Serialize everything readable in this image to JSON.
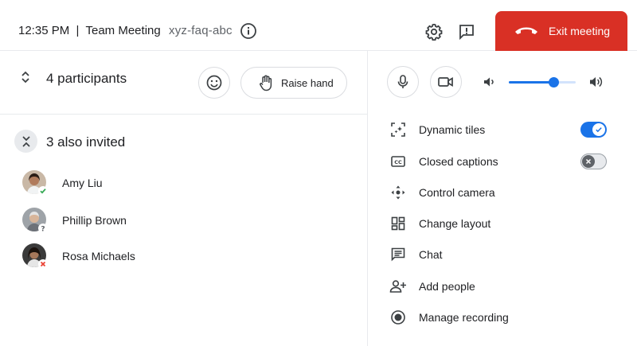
{
  "header": {
    "time_title": "12:35 PM  |  Team Meeting",
    "meeting_code": "xyz-faq-abc",
    "exit_label": "Exit meeting"
  },
  "participants": {
    "count_label": "4 participants",
    "raise_hand_label": "Raise hand",
    "invited_label": "3 also invited",
    "people": [
      {
        "name": "Amy Liu",
        "status": "accepted"
      },
      {
        "name": "Phillip Brown",
        "status": "maybe"
      },
      {
        "name": "Rosa Michaels",
        "status": "declined"
      }
    ]
  },
  "audio": {
    "volume_fraction": 0.67
  },
  "menu": {
    "items": [
      {
        "label": "Dynamic tiles",
        "icon": "dynamic-tiles-icon",
        "toggle": true
      },
      {
        "label": "Closed captions",
        "icon": "closed-captions-icon",
        "toggle": false
      },
      {
        "label": "Control camera",
        "icon": "control-camera-icon"
      },
      {
        "label": "Change layout",
        "icon": "layout-icon"
      },
      {
        "label": "Chat",
        "icon": "chat-icon"
      },
      {
        "label": "Add people",
        "icon": "add-people-icon"
      },
      {
        "label": "Manage recording",
        "icon": "record-icon"
      }
    ]
  },
  "colors": {
    "exit_red": "#d93025",
    "accent_blue": "#1a73e8",
    "status_green": "#34a853",
    "status_red": "#ea4335",
    "status_grey": "#5f6368"
  }
}
